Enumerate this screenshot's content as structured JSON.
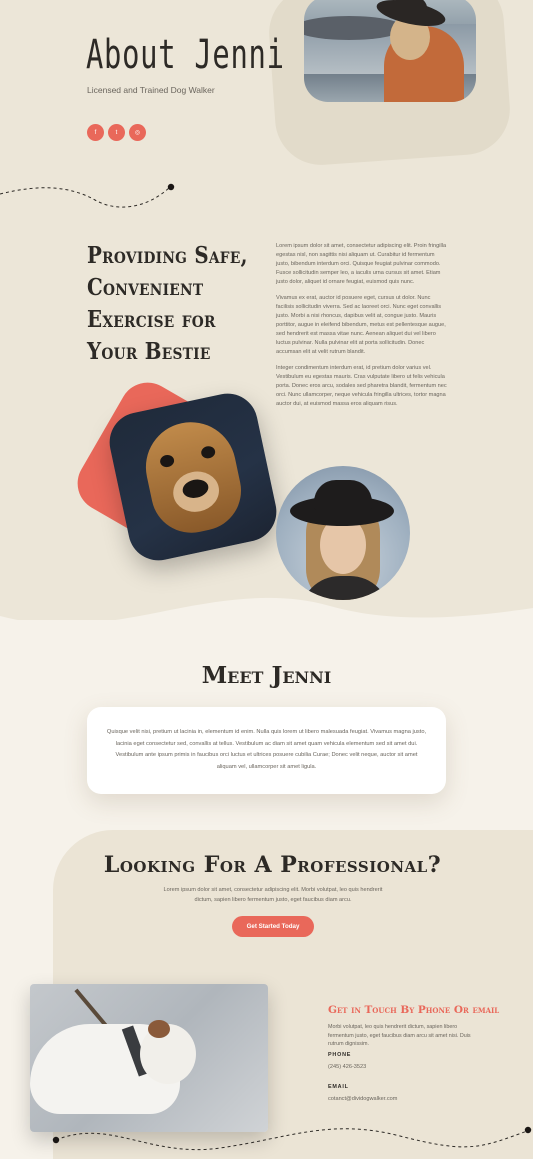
{
  "hero": {
    "title": "About Jenni",
    "subtitle": "Licensed and Trained Dog Walker",
    "social": [
      {
        "icon": "facebook-icon",
        "glyph": "f"
      },
      {
        "icon": "twitter-icon",
        "glyph": "t"
      },
      {
        "icon": "instagram-icon",
        "glyph": "◎"
      }
    ]
  },
  "about": {
    "heading": "Providing Safe, Convenient Exercise for Your Bestie",
    "paragraphs": [
      "Lorem ipsum dolor sit amet, consectetur adipiscing elit. Proin fringilla egestas nisl, non sagittis nisi aliquam ut. Curabitur id fermentum justo, bibendum interdum orci. Quisque feugiat pulvinar commodo. Fusce sollicitudin semper leo, a iaculis urna cursus sit amet. Etiam justo dolor, aliquet id ornare feugiat, euismod quis nunc.",
      "Vivamus ex erat, auctor id posuere eget, cursus ut dolor. Nunc facilisis sollicitudin viverra. Sed ac laoreet orci. Nunc eget convallis justo. Morbi a nisi rhoncus, dapibus velit at, congue justo. Mauris porttitor, augue in eleifend bibendum, metus est pellentesque augue, sed hendrerit est massa vitae nunc. Aenean aliquet dui vel libero luctus pulvinar. Nulla pulvinar elit at porta sollicitudin. Donec accumsan elit at velit rutrum blandit.",
      "Integer condimentum interdum erat, id pretium dolor varius vel. Vestibulum eu egestas mauris. Cras vulputate libero ut felis vehicula porta. Donec eros arcu, sodales sed pharetra blandit, fermentum nec orci. Nunc ullamcorper, neque vehicula fringilla ultrices, tortor magna auctor dui, at euismod massa eros aliquam risus."
    ]
  },
  "meet": {
    "title": "Meet Jenni",
    "text": "Quisque velit nisi, pretium ut lacinia in, elementum id enim. Nulla quis lorem ut libero malesuada feugiat. Vivamus magna justo, lacinia eget consectetur sed, convallis at tellus. Vestibulum ac diam sit amet quam vehicula elementum sed sit amet dui. Vestibulum ante ipsum primis in faucibus orci luctus et ultrices posuere cubilia Curae; Donec velit neque, auctor sit amet aliquam vel, ullamcorper sit amet ligula."
  },
  "pro": {
    "title": "Looking For A Professional?",
    "text": "Lorem ipsum dolor sit amet, consectetur adipiscing elit. Morbi volutpat, leo quis hendrerit dictum, sapien libero fermentum justo, eget faucibus diam arcu.",
    "cta": "Get Started Today"
  },
  "contact": {
    "title": "Get in Touch By Phone Or email",
    "text": "Morbi volutpat, leo quis hendrerit dictum, sapien libero fermentum justo, eget faucibus diam arcu sit amet nisi. Duis rutrum dignissim.",
    "phone_label": "PHONE",
    "phone": "(245) 426-3523",
    "email_label": "EMAIL",
    "email": "cotanct@dividogwalker.com"
  },
  "colors": {
    "accent": "#e9685a",
    "background": "#ece6d8",
    "light": "#f6f2ea"
  }
}
